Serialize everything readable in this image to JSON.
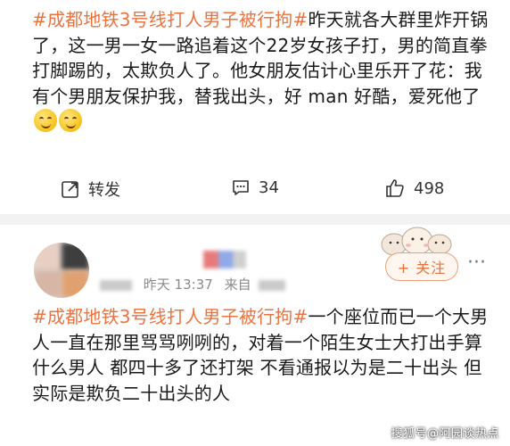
{
  "post1": {
    "hashtag": "#成都地铁3号线打人男子被行拘#",
    "text": "昨天就各大群里炸开锅了，这一男一女一路追着这个22岁女孩子打，男的简直拳打脚踢的，太欺负人了。他女朋友估计心里乐开了花：我有个男朋友保护我，替我出头，好 man 好酷，爱死他了"
  },
  "actions": {
    "repost_label": "转发",
    "comment_count": "34",
    "like_count": "498"
  },
  "comment_header": {
    "meta_time": "昨天 13:37",
    "meta_source": "来自",
    "follow_label": "+ 关注",
    "more_label": "···"
  },
  "post2": {
    "hashtag": "#成都地铁3号线打人男子被行拘#",
    "text": "一个座位而已一个大男人一直在那里骂骂咧咧的，对着一个陌生女士大打出手算什么男人 都四十多了还打架 不看通报以为是二十出头 但实际是欺负二十出头的人"
  },
  "watermark": "搜狐号@阿园谈热点",
  "colors": {
    "hashtag": "#eb7340",
    "follow": "#e9713b"
  }
}
